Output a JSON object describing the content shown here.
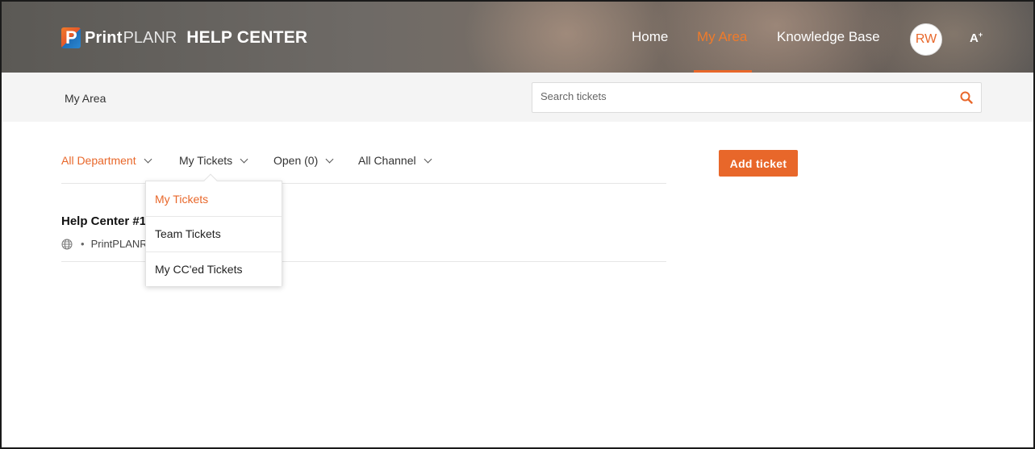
{
  "header": {
    "logo_print": "Print",
    "logo_planr": "PLANR",
    "logo_help": "HELP CENTER",
    "nav": {
      "home": "Home",
      "my_area": "My Area",
      "knowledge_base": "Knowledge Base"
    },
    "avatar_initials": "RW",
    "font_size_icon": "A",
    "accent_color": "#e8672a"
  },
  "subbar": {
    "breadcrumb": "My Area",
    "search_placeholder": "Search tickets"
  },
  "filters": {
    "department": "All Department",
    "tickets": "My Tickets",
    "status": "Open (0)",
    "channel": "All Channel"
  },
  "add_ticket_label": "Add ticket",
  "ticket": {
    "title": "Help Center #1",
    "meta": "PrintPLANR"
  },
  "dropdown": {
    "items": [
      {
        "label": "My Tickets",
        "active": true
      },
      {
        "label": "Team Tickets",
        "active": false
      },
      {
        "label": "My CC'ed Tickets",
        "active": false
      }
    ]
  }
}
